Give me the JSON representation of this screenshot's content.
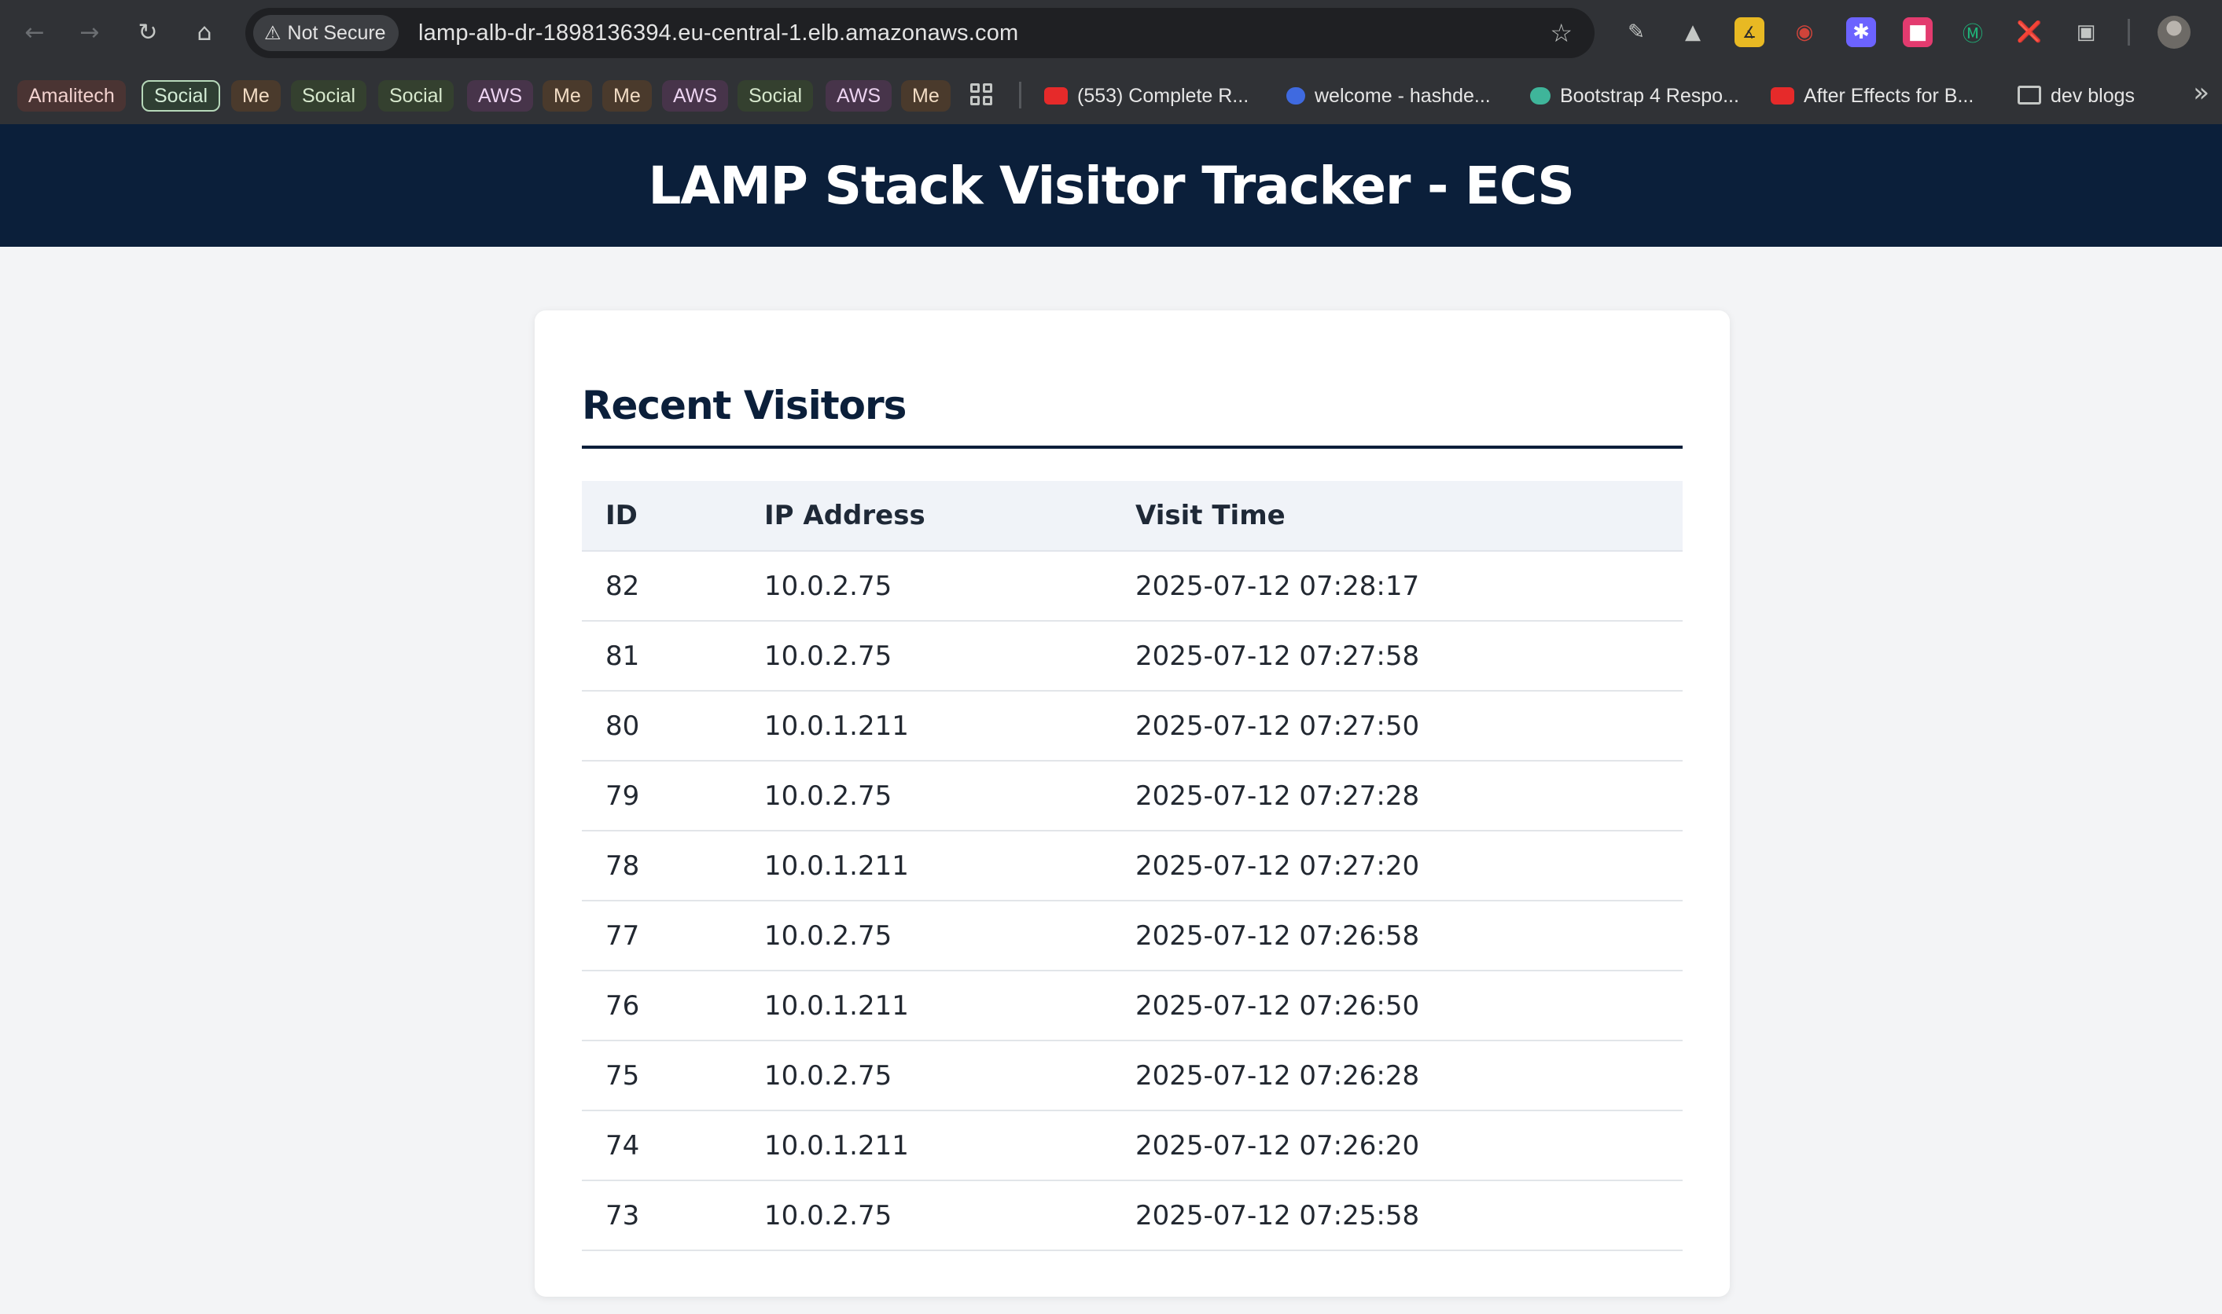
{
  "browser": {
    "security_label": "Not Secure",
    "url": "lamp-alb-dr-1898136394.eu-central-1.elb.amazonaws.com",
    "nav_icons": [
      "back-arrow-icon",
      "forward-arrow-icon",
      "reload-icon",
      "home-icon"
    ],
    "bookmark_groups": [
      "Amalitech",
      "Social",
      "Me",
      "Social",
      "Social",
      "AWS",
      "Me",
      "Me",
      "AWS",
      "Social",
      "AWS",
      "Me"
    ],
    "bookmarks": [
      "(553) Complete R...",
      "welcome - hashde...",
      "Bootstrap 4 Respo...",
      "After Effects for B...",
      "dev blogs"
    ]
  },
  "page": {
    "title": "LAMP Stack Visitor Tracker - ECS",
    "section_title": "Recent Visitors",
    "colors": {
      "header_bg": "#0b1f3a",
      "page_bg": "#f3f4f6",
      "table_head_bg": "#f0f3f8"
    }
  },
  "table": {
    "headers": [
      "ID",
      "IP Address",
      "Visit Time"
    ],
    "rows": [
      [
        "82",
        "10.0.2.75",
        "2025-07-12 07:28:17"
      ],
      [
        "81",
        "10.0.2.75",
        "2025-07-12 07:27:58"
      ],
      [
        "80",
        "10.0.1.211",
        "2025-07-12 07:27:50"
      ],
      [
        "79",
        "10.0.2.75",
        "2025-07-12 07:27:28"
      ],
      [
        "78",
        "10.0.1.211",
        "2025-07-12 07:27:20"
      ],
      [
        "77",
        "10.0.2.75",
        "2025-07-12 07:26:58"
      ],
      [
        "76",
        "10.0.1.211",
        "2025-07-12 07:26:50"
      ],
      [
        "75",
        "10.0.2.75",
        "2025-07-12 07:26:28"
      ],
      [
        "74",
        "10.0.1.211",
        "2025-07-12 07:26:20"
      ],
      [
        "73",
        "10.0.2.75",
        "2025-07-12 07:25:58"
      ]
    ]
  }
}
